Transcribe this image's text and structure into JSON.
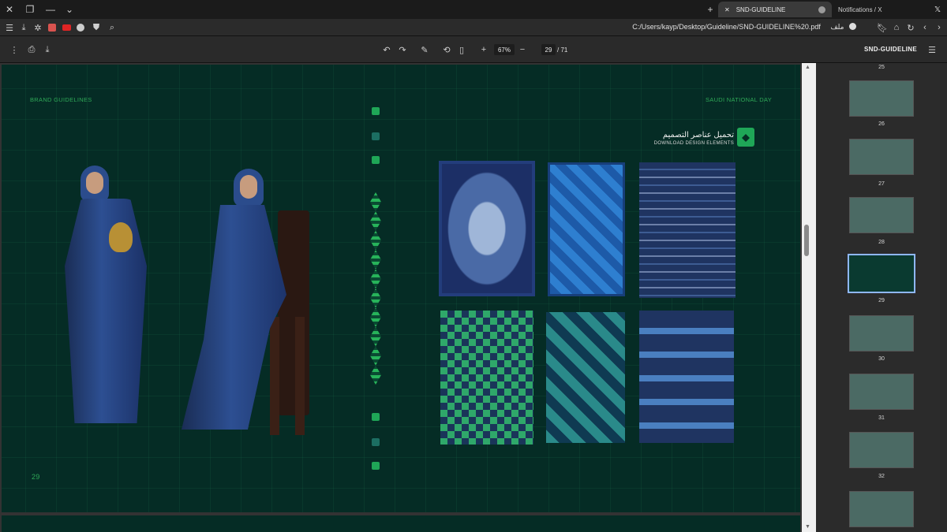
{
  "tabs": [
    {
      "label": "SND-GUIDELINE",
      "active": true
    },
    {
      "label": "Notifications / X",
      "active": false
    }
  ],
  "address": {
    "url": "C:/Users/kayp/Desktop/Guideline/SND-GUIDELINE%20.pdf",
    "file_label": "ملف"
  },
  "pdf_toolbar": {
    "zoom": "67%",
    "current_page": "29",
    "total_pages": "/ 71",
    "title": "SND-GUIDELINE"
  },
  "page": {
    "left_header": "BRAND GUIDELINES",
    "right_header": "SAUDI NATIONAL DAY",
    "page_number": "29",
    "download_ar": "تحميل عناصر التصميم",
    "download_en": "DOWNLOAD DESIGN ELEMENTS"
  },
  "thumbnails": [
    {
      "num": "25",
      "active": false
    },
    {
      "num": "26",
      "active": false
    },
    {
      "num": "27",
      "active": false
    },
    {
      "num": "28",
      "active": false
    },
    {
      "num": "29",
      "active": true
    },
    {
      "num": "30",
      "active": false
    },
    {
      "num": "31",
      "active": false
    },
    {
      "num": "32",
      "active": false
    }
  ],
  "colors": {
    "page_bg": "#052c25",
    "accent_green": "#2fa857",
    "rug_blue": "#2a4f8f"
  }
}
